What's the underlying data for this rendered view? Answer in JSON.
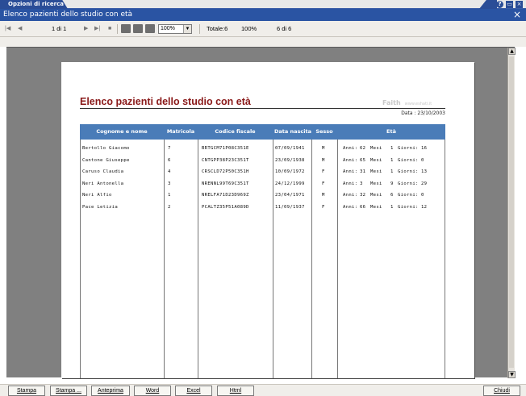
{
  "tab": {
    "label": "Opzioni di ricerca"
  },
  "window": {
    "title": "Elenco pazienti dello studio con età",
    "close_glyph": "×"
  },
  "toolbar": {
    "page_indicator": "1 di 1",
    "zoom": "100%",
    "total": "Totale:6",
    "percent": "100%",
    "count": "6 di 6"
  },
  "report": {
    "title": "Elenco pazienti dello studio con età",
    "logo": "Faith",
    "logo_url": "www.eshati.it",
    "date_label": "Data : 23/10/2003",
    "columns": [
      "Cognome e nome",
      "Matricola",
      "Codice fiscale",
      "Data nascita",
      "Sesso",
      "Età"
    ],
    "rows": [
      {
        "nome": "Bertollo Giacomo",
        "matricola": "7",
        "cf": "BRTGCM71P08C351E",
        "nascita": "07/09/1941",
        "sesso": "M",
        "anni": "62",
        "mesi": "1",
        "giorni": "16"
      },
      {
        "nome": "Cantone Giuseppe",
        "matricola": "6",
        "cf": "CNTGPP38P23C351T",
        "nascita": "23/09/1938",
        "sesso": "M",
        "anni": "65",
        "mesi": "1",
        "giorni": "0"
      },
      {
        "nome": "Caruso Claudia",
        "matricola": "4",
        "cf": "CRSCLD72P50C351H",
        "nascita": "10/09/1972",
        "sesso": "F",
        "anni": "31",
        "mesi": "1",
        "giorni": "13"
      },
      {
        "nome": "Neri Antonella",
        "matricola": "3",
        "cf": "NRENNL99T69C351T",
        "nascita": "24/12/1999",
        "sesso": "F",
        "anni": "3",
        "mesi": "9",
        "giorni": "29"
      },
      {
        "nome": "Neri Alfio",
        "matricola": "1",
        "cf": "NRELFA71D23D969Z",
        "nascita": "23/04/1971",
        "sesso": "M",
        "anni": "32",
        "mesi": "6",
        "giorni": "0"
      },
      {
        "nome": "Pace Letizia",
        "matricola": "2",
        "cf": "PCALTZ35P51A089D",
        "nascita": "11/09/1937",
        "sesso": "F",
        "anni": "66",
        "mesi": "1",
        "giorni": "12"
      }
    ],
    "age_labels": {
      "anni": "Anni:",
      "mesi": "Mesi",
      "giorni": "Giorni:"
    }
  },
  "buttons": {
    "stampa": "Stampa",
    "stampa_dialog": "Stampa ...",
    "anteprima": "Anteprima",
    "word": "Word",
    "excel": "Excel",
    "html": "Html",
    "chiudi": "Chiudi"
  },
  "colors": {
    "title_bar": "#2a54a3",
    "header_row": "#4a7cb8",
    "report_title": "#8a1a1a"
  }
}
